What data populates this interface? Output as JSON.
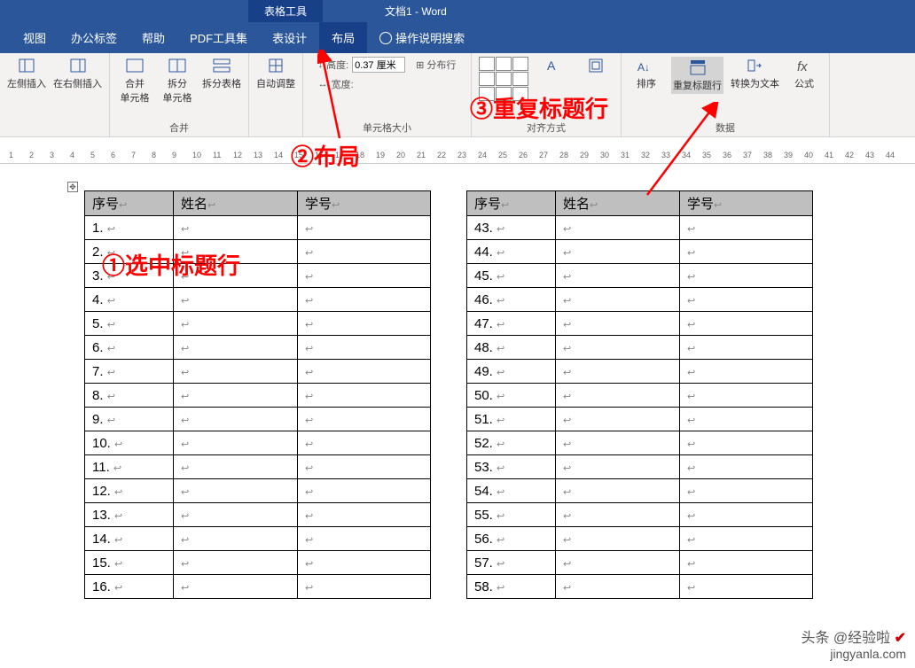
{
  "title": {
    "tableTools": "表格工具",
    "doc": "文档1  -  Word"
  },
  "tabs": [
    "视图",
    "办公标签",
    "帮助",
    "PDF工具集",
    "表设计",
    "布局"
  ],
  "tellMe": "操作说明搜索",
  "ribbon": {
    "insert": {
      "left": "左侧插入",
      "right": "在右侧插入"
    },
    "merge": {
      "merge": "合并\n单元格",
      "splitCell": "拆分\n单元格",
      "splitTable": "拆分表格",
      "group": "合并"
    },
    "auto": "自动调整",
    "size": {
      "height": "高度:",
      "heightVal": "0.37 厘米",
      "width": "宽度:",
      "dist": "分布行",
      "group": "单元格大小"
    },
    "align": {
      "dir": "文字方向",
      "margin": "单元格\n边距",
      "group": "对齐方式"
    },
    "data": {
      "sort": "排序",
      "repeat": "重复标题行",
      "convert": "转换为文本",
      "formula": "公式",
      "group": "数据"
    }
  },
  "ruler": [
    1,
    2,
    3,
    4,
    5,
    6,
    7,
    8,
    9,
    10,
    11,
    12,
    13,
    14,
    15,
    16,
    17,
    18,
    19,
    20,
    21,
    22,
    23,
    24,
    25,
    26,
    27,
    28,
    29,
    30,
    31,
    32,
    33,
    34,
    35,
    36,
    37,
    38,
    39,
    40,
    41,
    42,
    43,
    44
  ],
  "table": {
    "headers": [
      "序号",
      "姓名",
      "学号"
    ],
    "rowsLeft": [
      "1.",
      "2.",
      "3.",
      "4.",
      "5.",
      "6.",
      "7.",
      "8.",
      "9.",
      "10.",
      "11.",
      "12.",
      "13.",
      "14.",
      "15.",
      "16."
    ],
    "rowsRight": [
      "43.",
      "44.",
      "45.",
      "46.",
      "47.",
      "48.",
      "49.",
      "50.",
      "51.",
      "52.",
      "53.",
      "54.",
      "55.",
      "56.",
      "57.",
      "58."
    ]
  },
  "annotations": {
    "step1": "①选中标题行",
    "step2": "②布局",
    "step3": "③重复标题行"
  },
  "watermark": {
    "line1": "头条 @经验啦",
    "line2": "jingyanla.com"
  }
}
